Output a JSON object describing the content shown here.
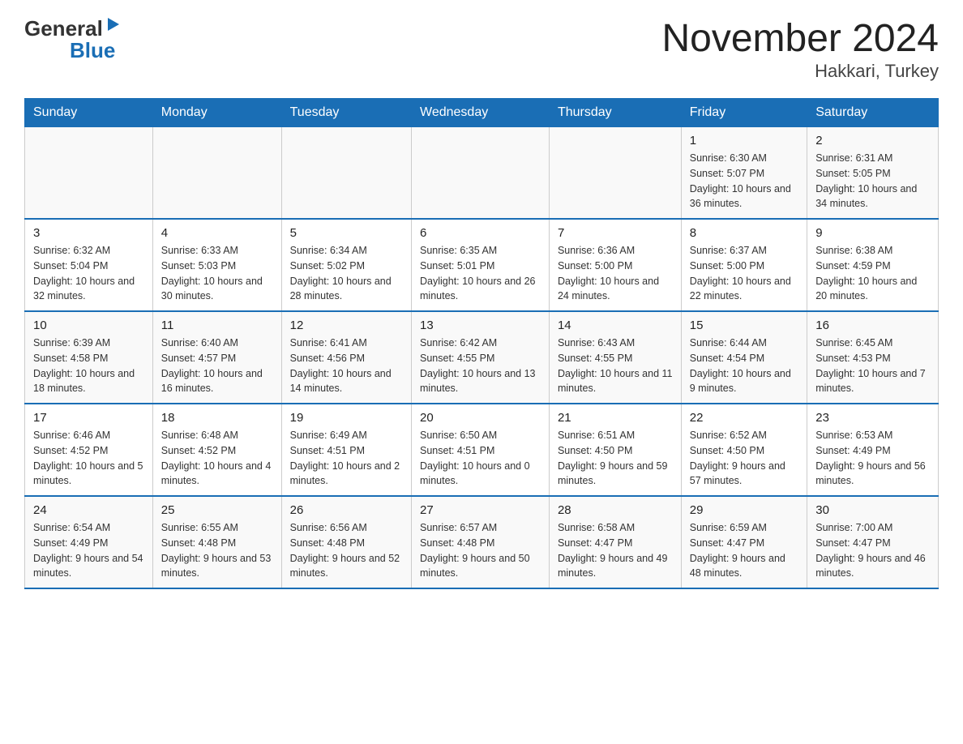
{
  "header": {
    "logo_general": "General",
    "logo_blue": "Blue",
    "month_title": "November 2024",
    "location": "Hakkari, Turkey"
  },
  "days_of_week": [
    "Sunday",
    "Monday",
    "Tuesday",
    "Wednesday",
    "Thursday",
    "Friday",
    "Saturday"
  ],
  "weeks": [
    [
      {
        "day": "",
        "sunrise": "",
        "sunset": "",
        "daylight": ""
      },
      {
        "day": "",
        "sunrise": "",
        "sunset": "",
        "daylight": ""
      },
      {
        "day": "",
        "sunrise": "",
        "sunset": "",
        "daylight": ""
      },
      {
        "day": "",
        "sunrise": "",
        "sunset": "",
        "daylight": ""
      },
      {
        "day": "",
        "sunrise": "",
        "sunset": "",
        "daylight": ""
      },
      {
        "day": "1",
        "sunrise": "Sunrise: 6:30 AM",
        "sunset": "Sunset: 5:07 PM",
        "daylight": "Daylight: 10 hours and 36 minutes."
      },
      {
        "day": "2",
        "sunrise": "Sunrise: 6:31 AM",
        "sunset": "Sunset: 5:05 PM",
        "daylight": "Daylight: 10 hours and 34 minutes."
      }
    ],
    [
      {
        "day": "3",
        "sunrise": "Sunrise: 6:32 AM",
        "sunset": "Sunset: 5:04 PM",
        "daylight": "Daylight: 10 hours and 32 minutes."
      },
      {
        "day": "4",
        "sunrise": "Sunrise: 6:33 AM",
        "sunset": "Sunset: 5:03 PM",
        "daylight": "Daylight: 10 hours and 30 minutes."
      },
      {
        "day": "5",
        "sunrise": "Sunrise: 6:34 AM",
        "sunset": "Sunset: 5:02 PM",
        "daylight": "Daylight: 10 hours and 28 minutes."
      },
      {
        "day": "6",
        "sunrise": "Sunrise: 6:35 AM",
        "sunset": "Sunset: 5:01 PM",
        "daylight": "Daylight: 10 hours and 26 minutes."
      },
      {
        "day": "7",
        "sunrise": "Sunrise: 6:36 AM",
        "sunset": "Sunset: 5:00 PM",
        "daylight": "Daylight: 10 hours and 24 minutes."
      },
      {
        "day": "8",
        "sunrise": "Sunrise: 6:37 AM",
        "sunset": "Sunset: 5:00 PM",
        "daylight": "Daylight: 10 hours and 22 minutes."
      },
      {
        "day": "9",
        "sunrise": "Sunrise: 6:38 AM",
        "sunset": "Sunset: 4:59 PM",
        "daylight": "Daylight: 10 hours and 20 minutes."
      }
    ],
    [
      {
        "day": "10",
        "sunrise": "Sunrise: 6:39 AM",
        "sunset": "Sunset: 4:58 PM",
        "daylight": "Daylight: 10 hours and 18 minutes."
      },
      {
        "day": "11",
        "sunrise": "Sunrise: 6:40 AM",
        "sunset": "Sunset: 4:57 PM",
        "daylight": "Daylight: 10 hours and 16 minutes."
      },
      {
        "day": "12",
        "sunrise": "Sunrise: 6:41 AM",
        "sunset": "Sunset: 4:56 PM",
        "daylight": "Daylight: 10 hours and 14 minutes."
      },
      {
        "day": "13",
        "sunrise": "Sunrise: 6:42 AM",
        "sunset": "Sunset: 4:55 PM",
        "daylight": "Daylight: 10 hours and 13 minutes."
      },
      {
        "day": "14",
        "sunrise": "Sunrise: 6:43 AM",
        "sunset": "Sunset: 4:55 PM",
        "daylight": "Daylight: 10 hours and 11 minutes."
      },
      {
        "day": "15",
        "sunrise": "Sunrise: 6:44 AM",
        "sunset": "Sunset: 4:54 PM",
        "daylight": "Daylight: 10 hours and 9 minutes."
      },
      {
        "day": "16",
        "sunrise": "Sunrise: 6:45 AM",
        "sunset": "Sunset: 4:53 PM",
        "daylight": "Daylight: 10 hours and 7 minutes."
      }
    ],
    [
      {
        "day": "17",
        "sunrise": "Sunrise: 6:46 AM",
        "sunset": "Sunset: 4:52 PM",
        "daylight": "Daylight: 10 hours and 5 minutes."
      },
      {
        "day": "18",
        "sunrise": "Sunrise: 6:48 AM",
        "sunset": "Sunset: 4:52 PM",
        "daylight": "Daylight: 10 hours and 4 minutes."
      },
      {
        "day": "19",
        "sunrise": "Sunrise: 6:49 AM",
        "sunset": "Sunset: 4:51 PM",
        "daylight": "Daylight: 10 hours and 2 minutes."
      },
      {
        "day": "20",
        "sunrise": "Sunrise: 6:50 AM",
        "sunset": "Sunset: 4:51 PM",
        "daylight": "Daylight: 10 hours and 0 minutes."
      },
      {
        "day": "21",
        "sunrise": "Sunrise: 6:51 AM",
        "sunset": "Sunset: 4:50 PM",
        "daylight": "Daylight: 9 hours and 59 minutes."
      },
      {
        "day": "22",
        "sunrise": "Sunrise: 6:52 AM",
        "sunset": "Sunset: 4:50 PM",
        "daylight": "Daylight: 9 hours and 57 minutes."
      },
      {
        "day": "23",
        "sunrise": "Sunrise: 6:53 AM",
        "sunset": "Sunset: 4:49 PM",
        "daylight": "Daylight: 9 hours and 56 minutes."
      }
    ],
    [
      {
        "day": "24",
        "sunrise": "Sunrise: 6:54 AM",
        "sunset": "Sunset: 4:49 PM",
        "daylight": "Daylight: 9 hours and 54 minutes."
      },
      {
        "day": "25",
        "sunrise": "Sunrise: 6:55 AM",
        "sunset": "Sunset: 4:48 PM",
        "daylight": "Daylight: 9 hours and 53 minutes."
      },
      {
        "day": "26",
        "sunrise": "Sunrise: 6:56 AM",
        "sunset": "Sunset: 4:48 PM",
        "daylight": "Daylight: 9 hours and 52 minutes."
      },
      {
        "day": "27",
        "sunrise": "Sunrise: 6:57 AM",
        "sunset": "Sunset: 4:48 PM",
        "daylight": "Daylight: 9 hours and 50 minutes."
      },
      {
        "day": "28",
        "sunrise": "Sunrise: 6:58 AM",
        "sunset": "Sunset: 4:47 PM",
        "daylight": "Daylight: 9 hours and 49 minutes."
      },
      {
        "day": "29",
        "sunrise": "Sunrise: 6:59 AM",
        "sunset": "Sunset: 4:47 PM",
        "daylight": "Daylight: 9 hours and 48 minutes."
      },
      {
        "day": "30",
        "sunrise": "Sunrise: 7:00 AM",
        "sunset": "Sunset: 4:47 PM",
        "daylight": "Daylight: 9 hours and 46 minutes."
      }
    ]
  ]
}
